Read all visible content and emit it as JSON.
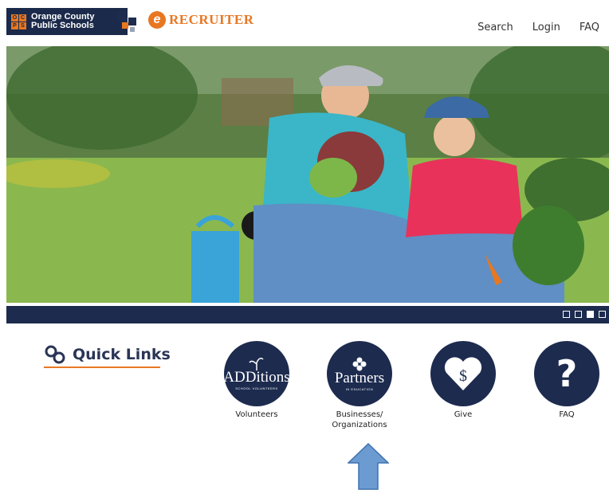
{
  "header": {
    "logo_letters": [
      "O",
      "C",
      "P",
      "S"
    ],
    "logo_line1": "Orange County",
    "logo_line2": "Public Schools",
    "recruiter_label": "RECRUITER",
    "nav": [
      {
        "label": "Search"
      },
      {
        "label": "Login"
      },
      {
        "label": "FAQ"
      }
    ]
  },
  "hero": {
    "slides_count": 4,
    "active_slide": 3
  },
  "quick_links": {
    "title": "Quick Links",
    "items": [
      {
        "label": "Volunteers",
        "logo_main": "ADDitions",
        "logo_sub": "SCHOOL VOLUNTEERS",
        "icon": "sprout-icon"
      },
      {
        "label": "Businesses/\nOrganizations",
        "logo_main": "Partners",
        "logo_sub": "IN EDUCATION",
        "icon": "diamond-flower-icon"
      },
      {
        "label": "Give",
        "logo_main": "$",
        "icon": "heart-dollar-icon"
      },
      {
        "label": "FAQ",
        "logo_main": "?",
        "icon": "question-icon"
      }
    ]
  },
  "colors": {
    "navy": "#1d2b4f",
    "orange": "#e87722",
    "arrow": "#6b9bd1"
  }
}
